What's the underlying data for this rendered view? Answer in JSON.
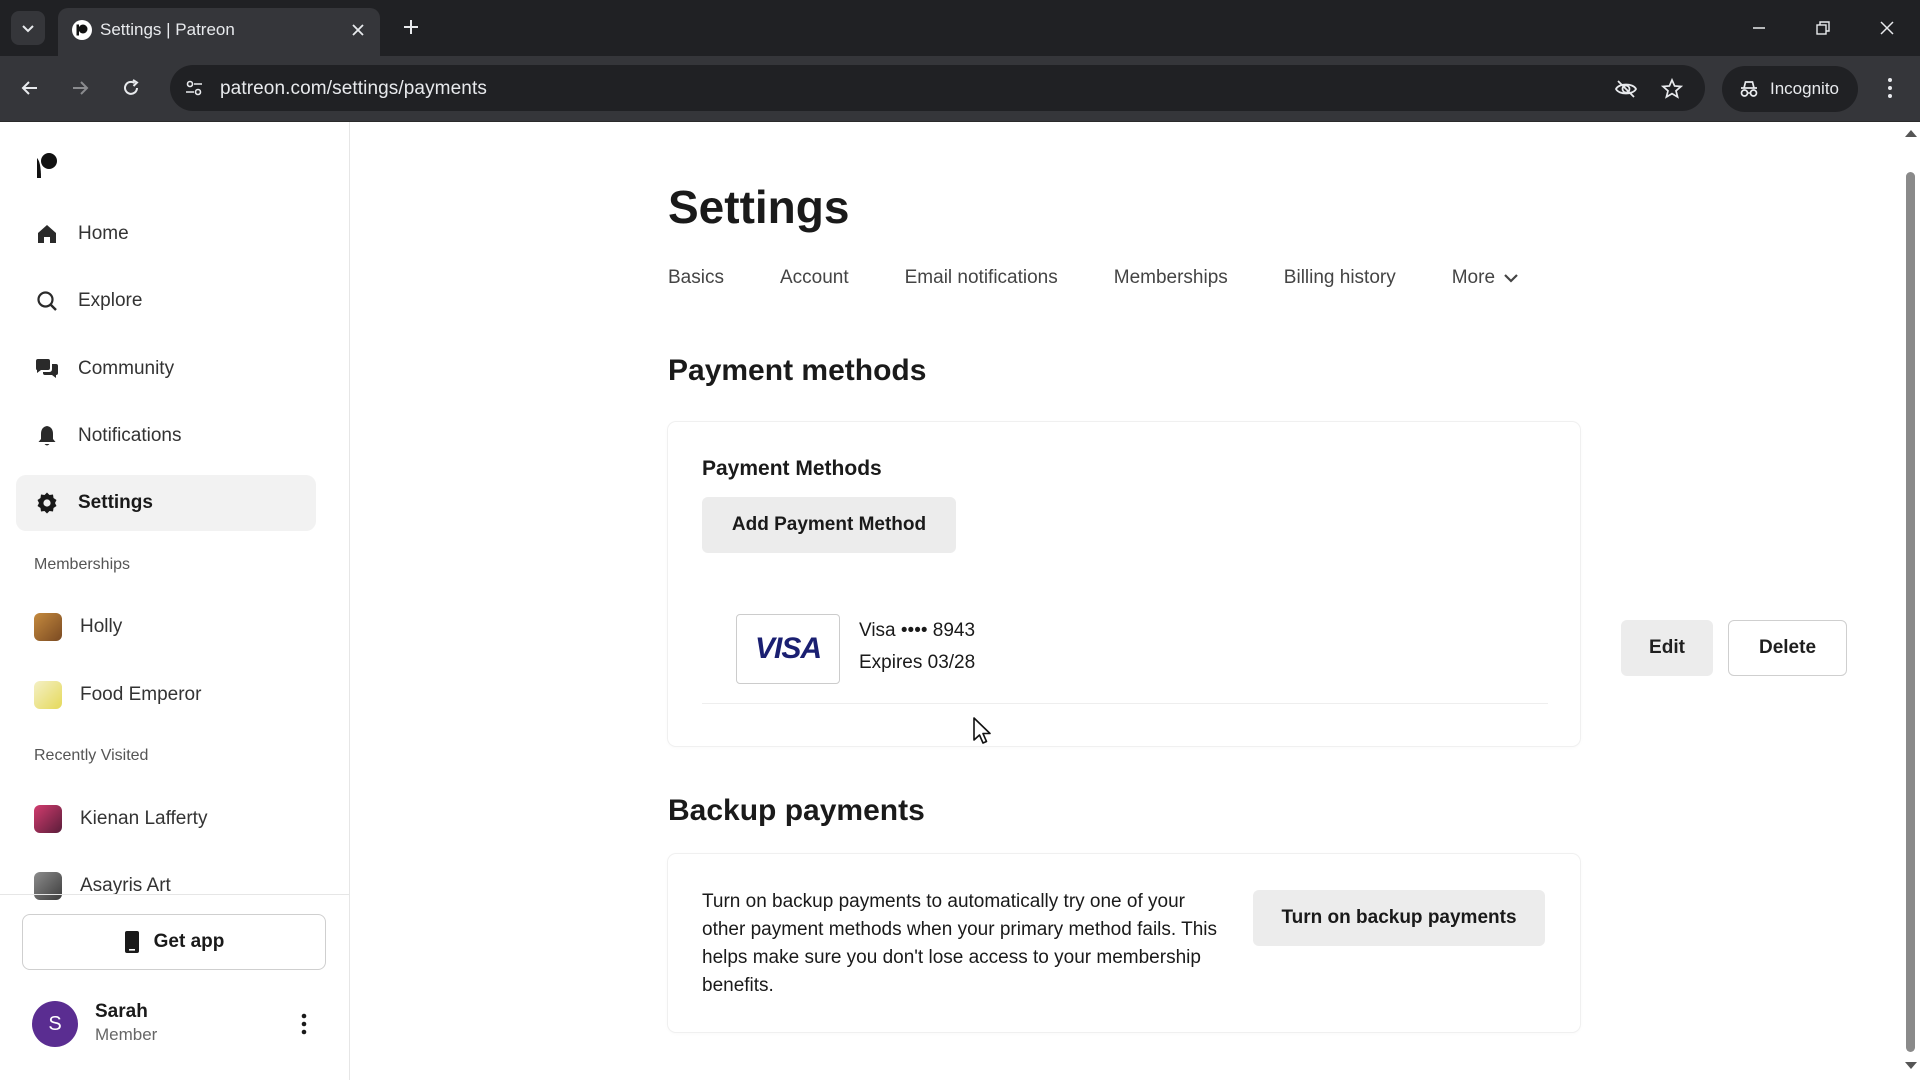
{
  "browser": {
    "tab_title": "Settings | Patreon",
    "url": "patreon.com/settings/payments",
    "incognito_label": "Incognito"
  },
  "sidebar": {
    "nav": [
      {
        "label": "Home",
        "icon": "home-icon"
      },
      {
        "label": "Explore",
        "icon": "search-icon"
      },
      {
        "label": "Community",
        "icon": "chat-icon"
      },
      {
        "label": "Notifications",
        "icon": "bell-icon"
      },
      {
        "label": "Settings",
        "icon": "gear-icon",
        "active": true
      }
    ],
    "memberships_label": "Memberships",
    "memberships": [
      {
        "label": "Holly"
      },
      {
        "label": "Food Emperor"
      }
    ],
    "recent_label": "Recently Visited",
    "recent": [
      {
        "label": "Kienan Lafferty"
      },
      {
        "label": "Asayris Art"
      }
    ],
    "get_app_label": "Get app",
    "user": {
      "initial": "S",
      "name": "Sarah",
      "role": "Member"
    }
  },
  "main": {
    "title": "Settings",
    "tabs": [
      {
        "label": "Basics"
      },
      {
        "label": "Account"
      },
      {
        "label": "Email notifications"
      },
      {
        "label": "Memberships"
      },
      {
        "label": "Billing history"
      },
      {
        "label": "More"
      }
    ],
    "payment_methods": {
      "section_title": "Payment methods",
      "card_title": "Payment Methods",
      "add_button": "Add Payment Method",
      "card_brand": "VISA",
      "card_number": "Visa •••• 8943",
      "card_expiry": "Expires 03/28",
      "edit_button": "Edit",
      "delete_button": "Delete"
    },
    "backup": {
      "section_title": "Backup payments",
      "description": "Turn on backup payments to automatically try one of your other payment methods when your primary method fails. This helps make sure you don't lose access to your membership benefits.",
      "button": "Turn on backup payments"
    }
  },
  "colors": {
    "chrome_dark": "#202124",
    "chrome_toolbar": "#35363a",
    "avatar_purple": "#5a2d91",
    "visa_blue": "#1a1f71"
  }
}
